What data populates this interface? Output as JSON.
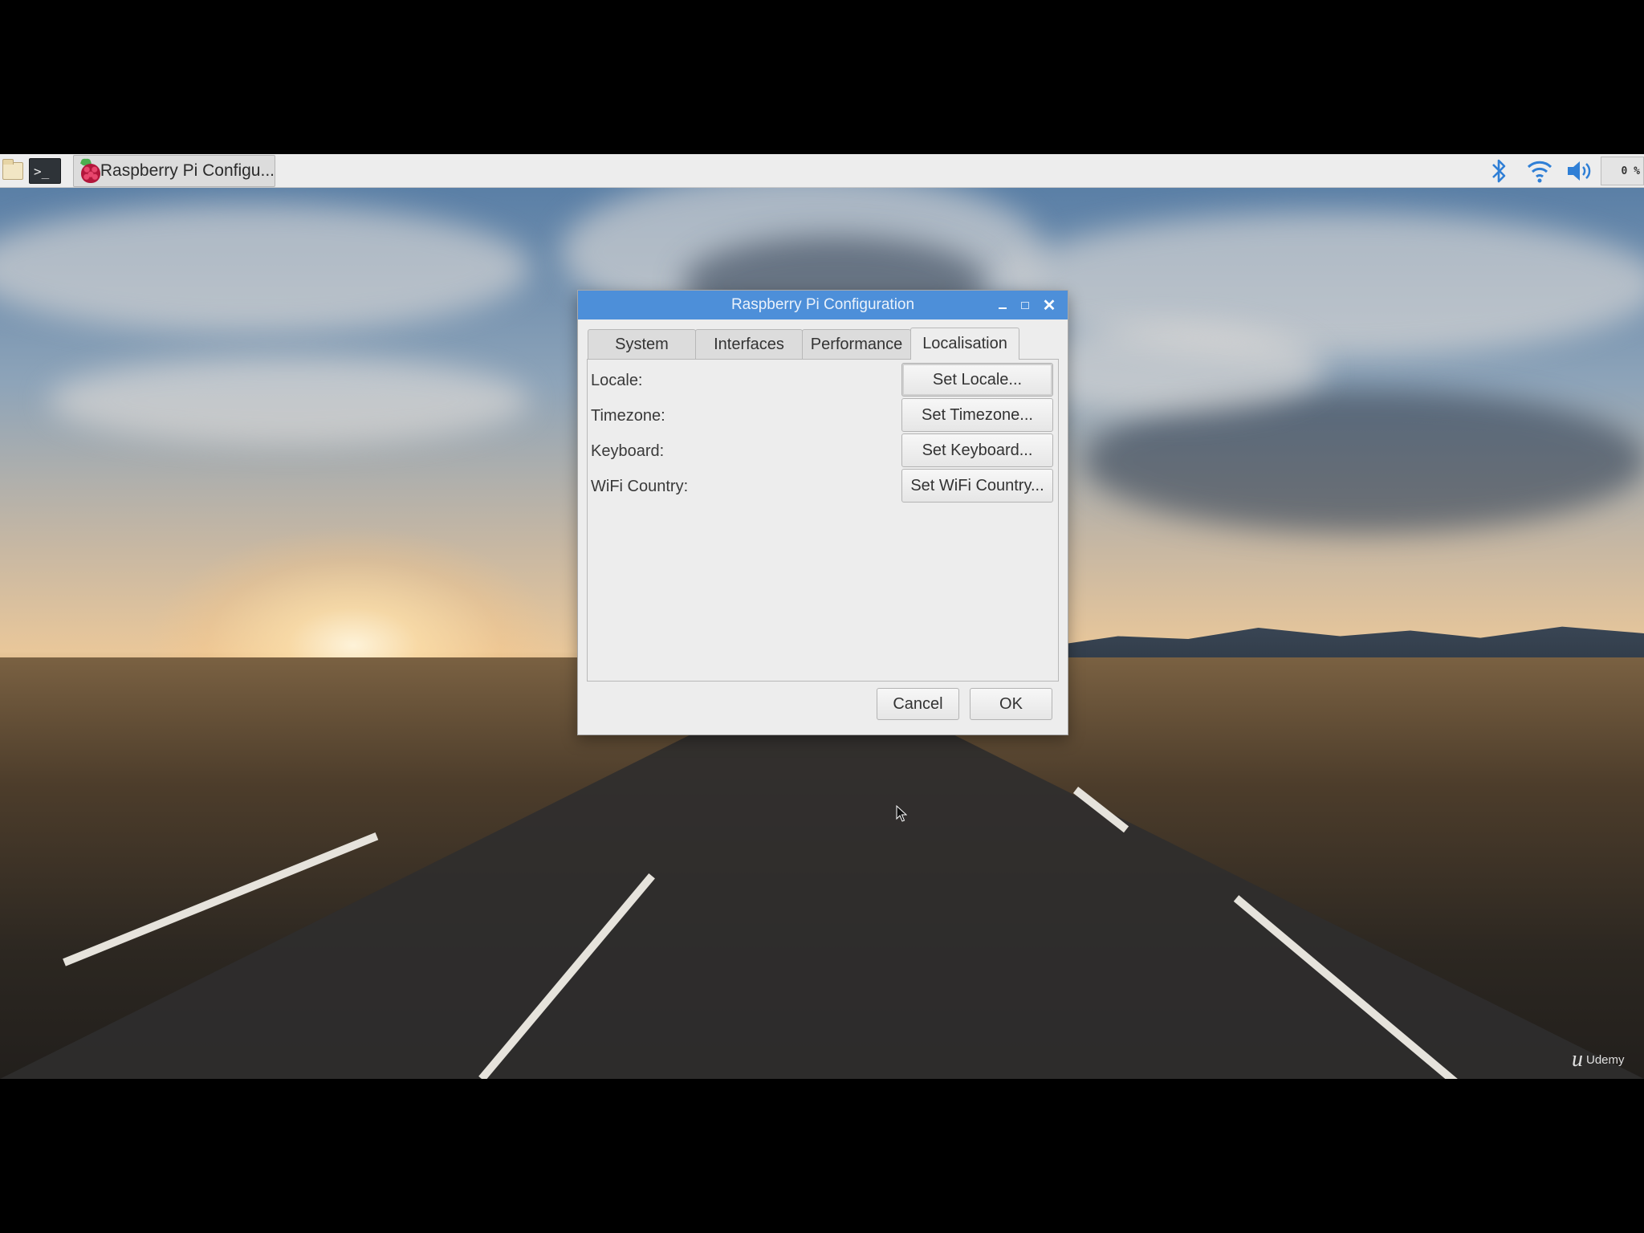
{
  "taskbar": {
    "file_manager_icon": "folder-icon",
    "terminal_icon": "terminal-icon",
    "terminal_glyph": ">_",
    "task_label": "Raspberry Pi Configu...",
    "task_icon": "raspberry-pi-icon",
    "tray": {
      "bluetooth_icon": "bluetooth-icon",
      "wifi_icon": "wifi-icon",
      "volume_icon": "volume-icon",
      "cpu_usage": "0 %"
    }
  },
  "dialog": {
    "title": "Raspberry Pi Configuration",
    "tabs": [
      {
        "label": "System"
      },
      {
        "label": "Interfaces"
      },
      {
        "label": "Performance"
      },
      {
        "label": "Localisation",
        "active": true
      }
    ],
    "rows": [
      {
        "label": "Locale:",
        "button": "Set Locale..."
      },
      {
        "label": "Timezone:",
        "button": "Set Timezone..."
      },
      {
        "label": "Keyboard:",
        "button": "Set Keyboard..."
      },
      {
        "label": "WiFi Country:",
        "button": "Set WiFi Country..."
      }
    ],
    "cancel_label": "Cancel",
    "ok_label": "OK"
  },
  "watermark": {
    "mark": "u",
    "text": "Udemy"
  },
  "colors": {
    "titlebar": "#4d8fd9",
    "dialog_bg": "#ededed",
    "taskbar_bg": "#ededed"
  }
}
